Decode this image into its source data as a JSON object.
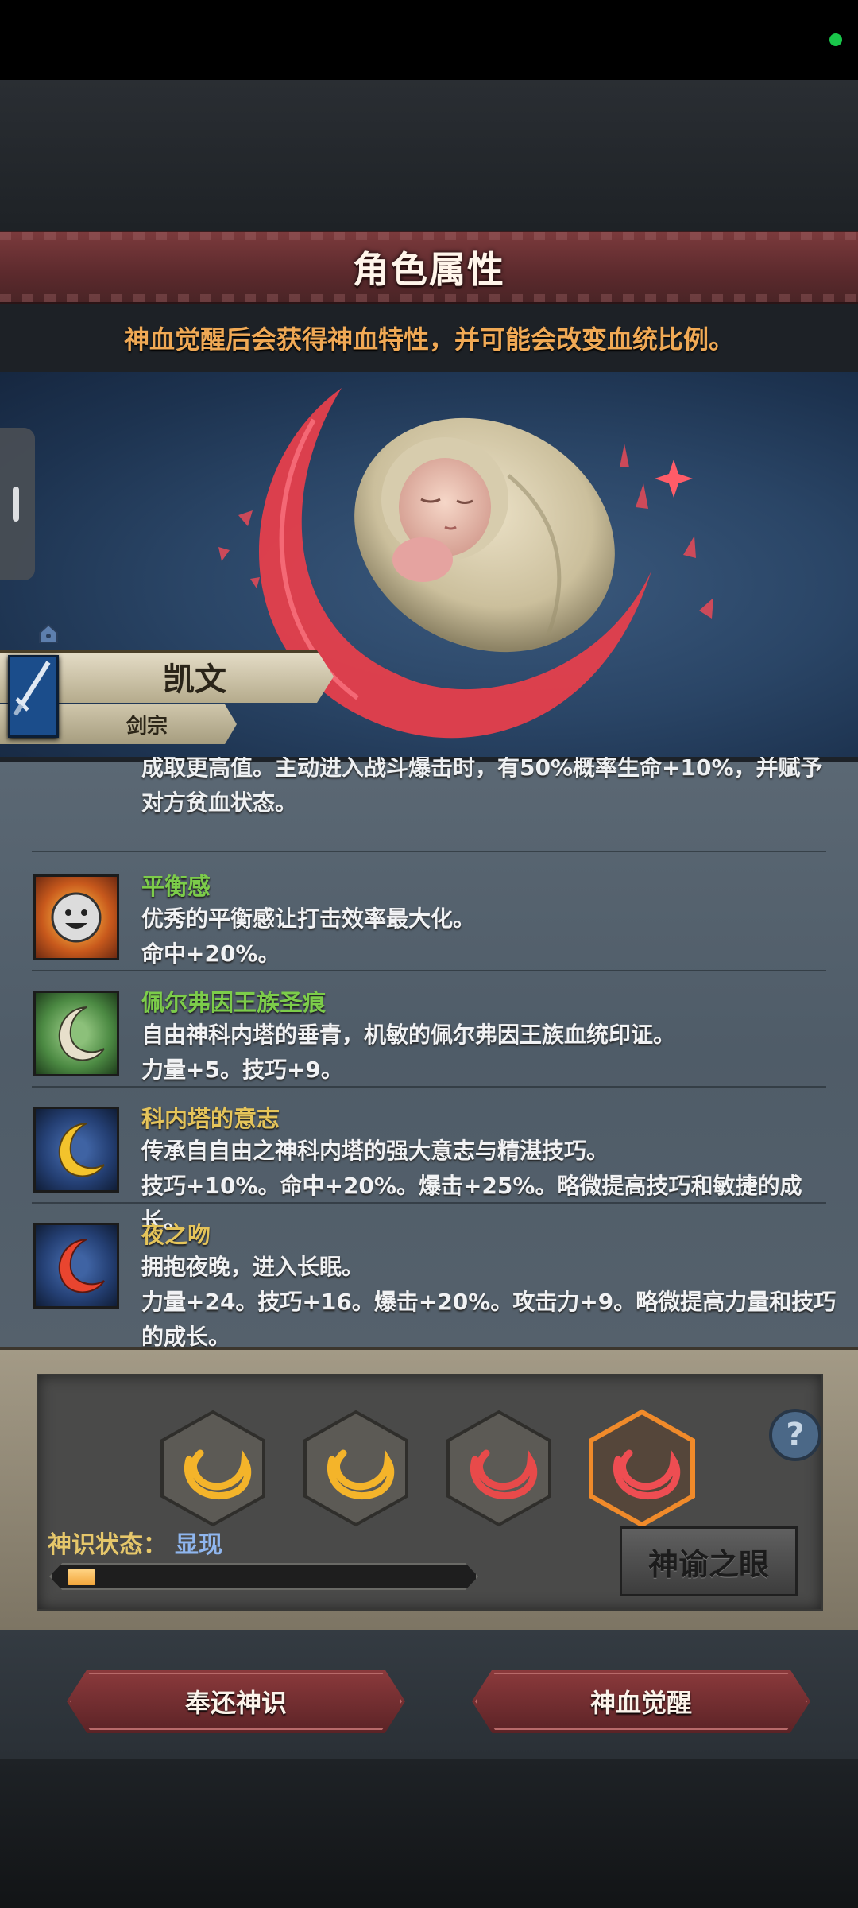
{
  "header": {
    "title": "角色属性"
  },
  "notice": "神血觉醒后会获得神血特性，并可能会改变血统比例。",
  "character": {
    "name": "凯文",
    "class": "剑宗"
  },
  "traits": {
    "partial_text": "成取更高值。主动进入战斗爆击时，有50%概率生命+10%，并赋予对方贫血状态。",
    "items": [
      {
        "name": "平衡感",
        "name_color": "#7ccc4a",
        "desc": "优秀的平衡感让打击效率最大化。\n命中+20%。",
        "icon": "smiley-sun-icon"
      },
      {
        "name": "佩尔弗因王族圣痕",
        "name_color": "#7ccc4a",
        "desc": "自由神科内塔的垂青，机敏的佩尔弗因王族血统印证。\n力量+5。技巧+9。",
        "icon": "white-crescent-icon"
      },
      {
        "name": "科内塔的意志",
        "name_color": "#e5c45a",
        "desc": "传承自自由之神科内塔的强大意志与精湛技巧。\n技巧+10%。命中+20%。爆击+25%。略微提高技巧和敏捷的成长。",
        "icon": "yellow-crescent-icon"
      },
      {
        "name": "夜之吻",
        "name_color": "#e5c45a",
        "desc": "拥抱夜晚，进入长眠。\n力量+24。技巧+16。爆击+20%。攻击力+9。略微提高力量和技巧的成长。",
        "icon": "red-crescent-icon"
      }
    ]
  },
  "divine": {
    "slots": [
      {
        "icon": "gold-crescent-icon",
        "color": "#f4b42a",
        "selected": false
      },
      {
        "icon": "gold-crescent-icon",
        "color": "#f4b42a",
        "selected": false
      },
      {
        "icon": "red-crescent-icon",
        "color": "#e84a4a",
        "selected": false
      },
      {
        "icon": "red-crescent-icon",
        "color": "#ee4d52",
        "selected": true
      }
    ],
    "state_label": "神识状态：",
    "state_value": "显现",
    "progress": 0.07,
    "eye_button": "神谕之眼",
    "help": "?"
  },
  "footer": {
    "return_button": "奉还神识",
    "awaken_button": "神血觉醒"
  }
}
